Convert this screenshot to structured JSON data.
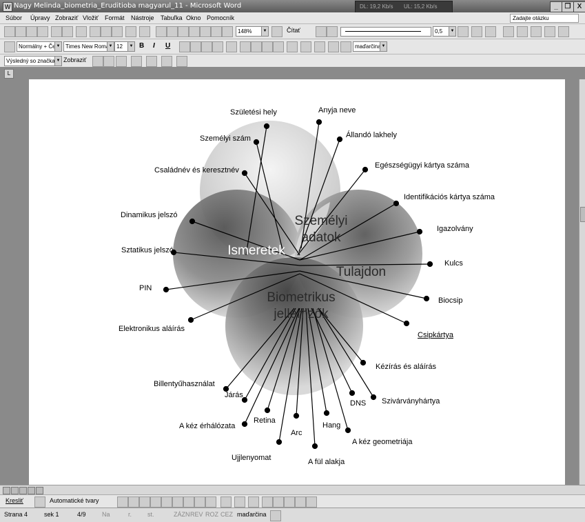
{
  "window": {
    "title": "Nagy Melinda_biometria_Eruditioba magyarul_11 - Microsoft Word",
    "net_down": "DL: 19,2 Kb/s",
    "net_up": "UL: 15,2 Kb/s",
    "minimize": "_",
    "restore": "❐",
    "close": "X"
  },
  "menu": {
    "items": [
      "Súbor",
      "Úpravy",
      "Zobraziť",
      "Vložiť",
      "Formát",
      "Nástroje",
      "Tabuľka",
      "Okno",
      "Pomocník"
    ],
    "ask_placeholder": "Zadajte otázku"
  },
  "toolbar_standard": {
    "zoom": "148%",
    "read_label": "Čítať",
    "line_width": "0,5"
  },
  "toolbar_format": {
    "style": "Normálny + Če",
    "font": "Times New Roman",
    "size": "12",
    "bold": "B",
    "italic": "I",
    "underline": "U",
    "language": "maďarčina"
  },
  "toolbar_review": {
    "view": "Výsledný so značkami",
    "show": "Zobraziť"
  },
  "ruler_tab_symbol": "L",
  "diagram": {
    "circles": {
      "personal": [
        "Személyi",
        "adatok"
      ],
      "knowledge": "Ismeretek",
      "possession": "Tulajdon",
      "biometric": [
        "Biometrikus",
        "jellemzők"
      ]
    },
    "labels": {
      "birth_place": "Születési hely",
      "mother_name": "Anyja neve",
      "personal_number": "Személyi szám",
      "address": "Állandó lakhely",
      "family_name": "Családnév és keresztnév",
      "health_card": "Egészségügyi kártya száma",
      "id_card": "Identifikációs kártya száma",
      "dynamic_password": "Dinamikus jelszó",
      "static_password": "Sztatikus jelszó",
      "certificate": "Igazolvány",
      "key": "Kulcs",
      "pin": "PIN",
      "biochip": "Biocsip",
      "e_signature": "Elektronikus aláírás",
      "chip_card": "Csipkártya",
      "handwriting": "Kézírás és aláírás",
      "keystroke": "Billentyűhasználat",
      "gait": "Járás",
      "iris": "Szivárványhártya",
      "dna": "DNS",
      "retina": "Retina",
      "hand_veins": "A kéz érhálózata",
      "voice": "Hang",
      "face": "Arc",
      "hand_geometry": "A kéz geometriája",
      "fingerprint": "Ujjlenyomat",
      "ear_shape": "A fül alakja"
    }
  },
  "status": {
    "page": "Strana 4",
    "section": "sek 1",
    "pages": "4/9",
    "at": "Na",
    "line": "r.",
    "col": "st.",
    "rec": "ZÁZN",
    "rev": "REV",
    "ext": "ROZ",
    "ovr": "CEZ",
    "language": "maďarčina"
  },
  "drawing": {
    "draw": "Kresliť",
    "autoshapes": "Automatické tvary"
  }
}
